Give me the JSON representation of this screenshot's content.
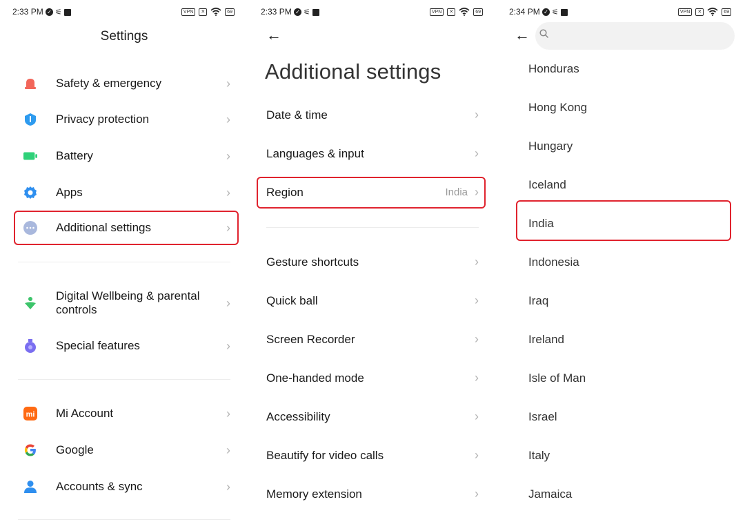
{
  "screens": [
    {
      "status": {
        "time": "2:33 PM",
        "vpn": "VPN",
        "battery": "69"
      },
      "title": "Settings",
      "items": [
        {
          "label": "Safety & emergency",
          "icon": "bell-icon",
          "color": "#f2665a"
        },
        {
          "label": "Privacy protection",
          "icon": "shield-icon",
          "color": "#2e9bef"
        },
        {
          "label": "Battery",
          "icon": "battery-icon",
          "color": "#2fd179"
        },
        {
          "label": "Apps",
          "icon": "gear-icon",
          "color": "#2f8fef"
        },
        {
          "label": "Additional settings",
          "icon": "more-dots-icon",
          "color": "#a9b8dd"
        },
        {
          "label": "Digital Wellbeing & parental controls",
          "icon": "wellbeing-icon",
          "color": "#3cc46a"
        },
        {
          "label": "Special features",
          "icon": "special-features-icon",
          "color": "#7a6ef0"
        },
        {
          "label": "Mi Account",
          "icon": "mi-logo-icon",
          "color": "#ff6a13"
        },
        {
          "label": "Google",
          "icon": "google-icon",
          "color": "#4285f4"
        },
        {
          "label": "Accounts & sync",
          "icon": "person-icon",
          "color": "#2f8fef"
        }
      ]
    },
    {
      "status": {
        "time": "2:33 PM",
        "vpn": "VPN",
        "battery": "69"
      },
      "title": "Additional settings",
      "items": [
        {
          "label": "Date & time"
        },
        {
          "label": "Languages & input"
        },
        {
          "label": "Region",
          "value": "India"
        },
        {
          "label": "Gesture shortcuts"
        },
        {
          "label": "Quick ball"
        },
        {
          "label": "Screen Recorder"
        },
        {
          "label": "One-handed mode"
        },
        {
          "label": "Accessibility"
        },
        {
          "label": "Beautify for video calls"
        },
        {
          "label": "Memory extension"
        }
      ]
    },
    {
      "status": {
        "time": "2:34 PM",
        "vpn": "VPN",
        "battery": "69"
      },
      "search": {
        "placeholder": "",
        "value": ""
      },
      "countries": [
        "Honduras",
        "Hong Kong",
        "Hungary",
        "Iceland",
        "India",
        "Indonesia",
        "Iraq",
        "Ireland",
        "Isle of Man",
        "Israel",
        "Italy",
        "Jamaica"
      ]
    }
  ],
  "highlight_color": "#e0232e"
}
